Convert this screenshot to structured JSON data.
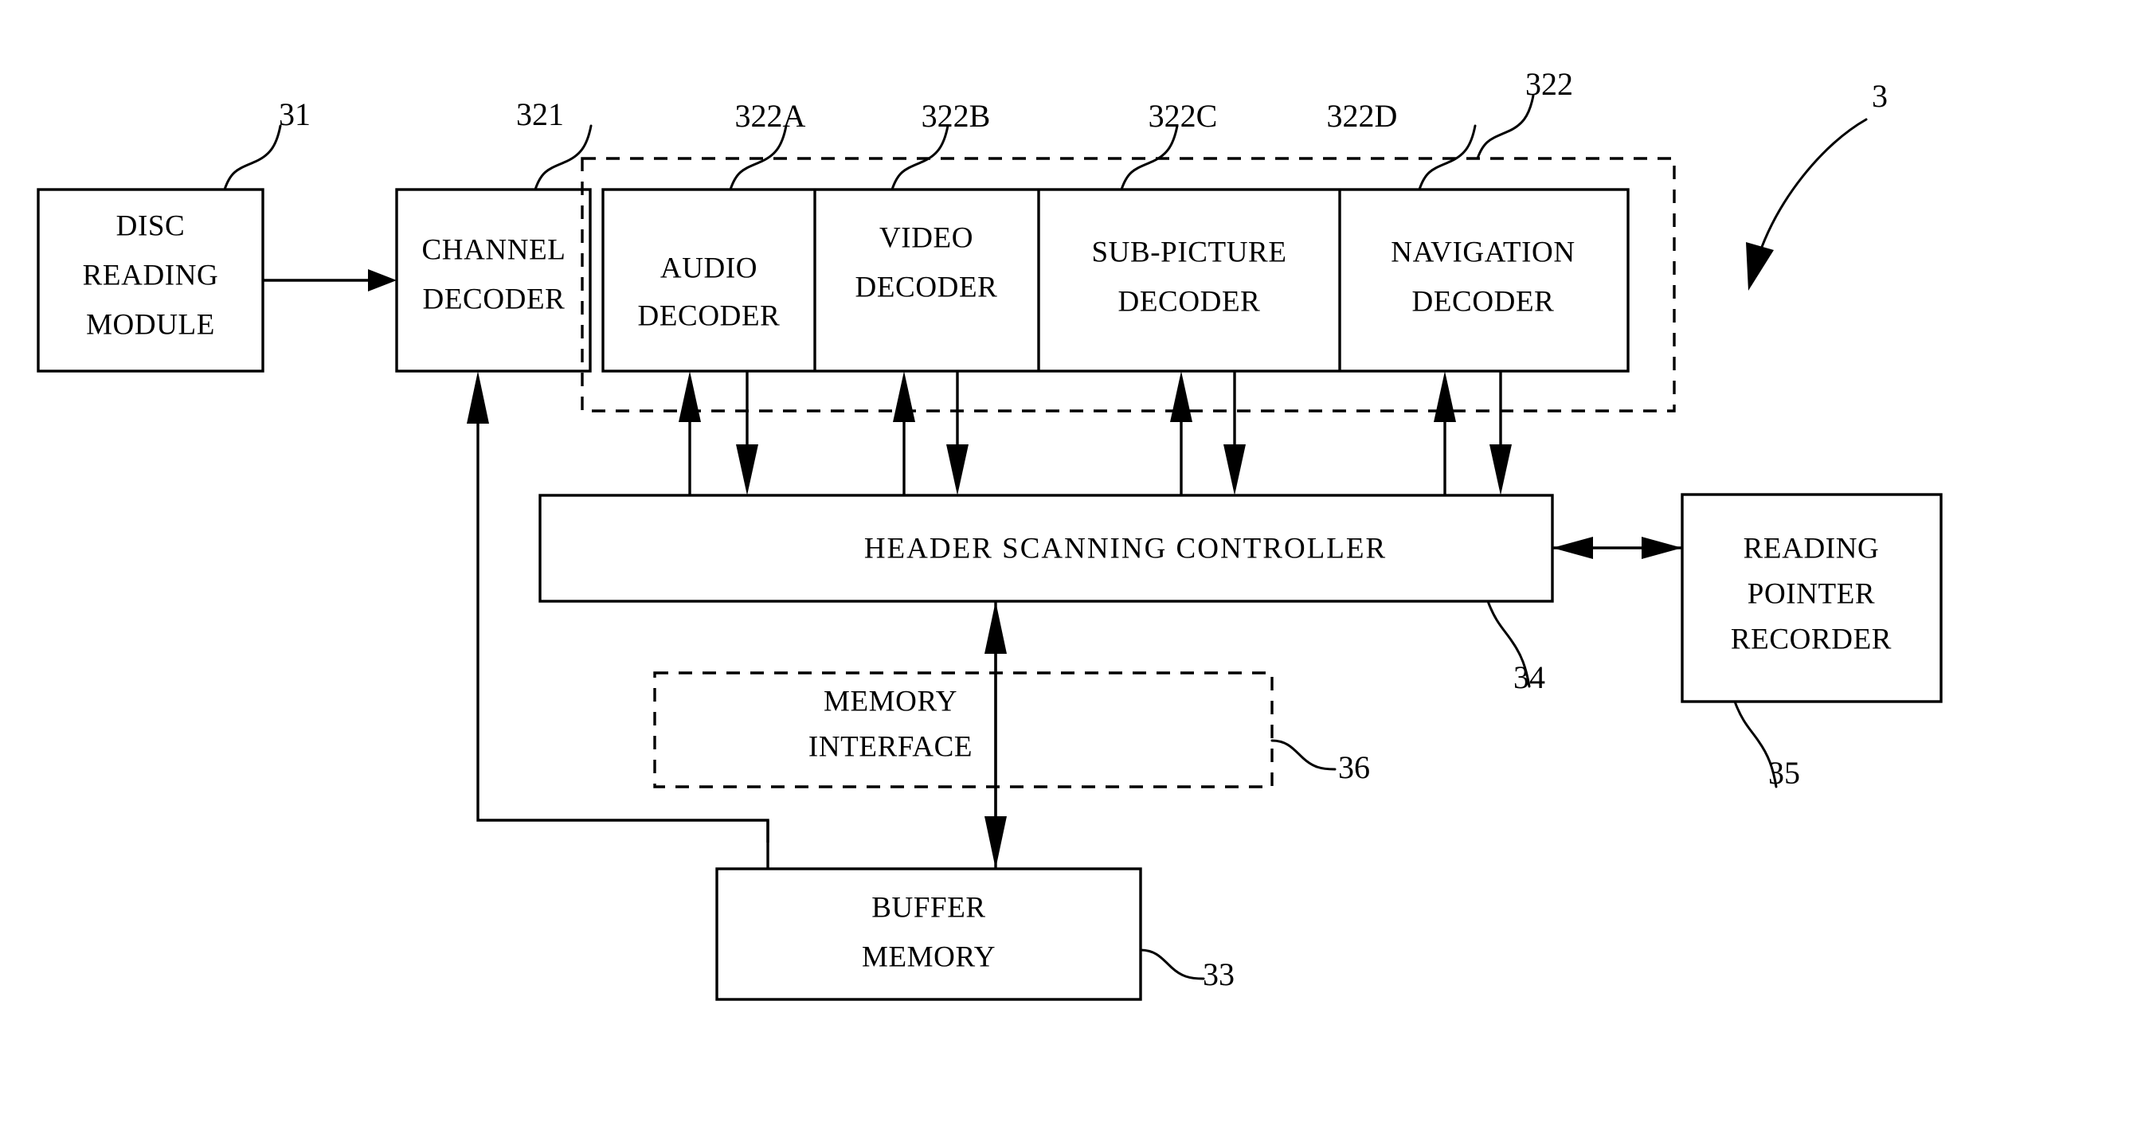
{
  "figure": {
    "type": "patent-block-diagram",
    "assembly_reference": "3",
    "background_color": "#ffffff",
    "line_color": "#000000"
  },
  "blocks": [
    {
      "id": "disc-reading-module",
      "lines": [
        "DISC",
        "READING",
        "MODULE"
      ],
      "reference": "31",
      "style": "solid"
    },
    {
      "id": "channel-decoder",
      "lines": [
        "CHANNEL",
        "DECODER"
      ],
      "reference": "321",
      "style": "solid"
    },
    {
      "id": "audio-decoder",
      "lines": [
        "AUDIO",
        "DECODER"
      ],
      "reference": "322A",
      "style": "solid"
    },
    {
      "id": "video-decoder",
      "lines": [
        "VIDEO",
        "DECODER"
      ],
      "reference": "322B",
      "style": "solid"
    },
    {
      "id": "sub-picture-decoder",
      "lines": [
        "SUB-PICTURE",
        "DECODER"
      ],
      "reference": "322C",
      "style": "solid"
    },
    {
      "id": "navigation-decoder",
      "lines": [
        "NAVIGATION",
        "DECODER"
      ],
      "reference": "322D",
      "style": "solid"
    },
    {
      "id": "decoder-group",
      "lines": [],
      "reference": "322",
      "style": "dashed"
    },
    {
      "id": "header-scanning-controller",
      "lines": [
        "HEADER SCANNING CONTROLLER"
      ],
      "reference": "34",
      "style": "solid"
    },
    {
      "id": "reading-pointer-recorder",
      "lines": [
        "READING",
        "POINTER",
        "RECORDER"
      ],
      "reference": "35",
      "style": "solid"
    },
    {
      "id": "memory-interface",
      "lines": [
        "MEMORY",
        "INTERFACE"
      ],
      "reference": "36",
      "style": "dashed"
    },
    {
      "id": "buffer-memory",
      "lines": [
        "BUFFER",
        "MEMORY"
      ],
      "reference": "33",
      "style": "solid"
    }
  ],
  "labels": {
    "disc_l1": "DISC",
    "disc_l2": "READING",
    "disc_l3": "MODULE",
    "channel_l1": "CHANNEL",
    "channel_l2": "DECODER",
    "audio_l1": "AUDIO",
    "audio_l2": "DECODER",
    "video_l1": "VIDEO",
    "video_l2": "DECODER",
    "subpic_l1": "SUB-PICTURE",
    "subpic_l2": "DECODER",
    "nav_l1": "NAVIGATION",
    "nav_l2": "DECODER",
    "hsc": "HEADER SCANNING CONTROLLER",
    "rpr_l1": "READING",
    "rpr_l2": "POINTER",
    "rpr_l3": "RECORDER",
    "mem_l1": "MEMORY",
    "mem_l2": "INTERFACE",
    "buf_l1": "BUFFER",
    "buf_l2": "MEMORY"
  },
  "references": {
    "r31": "31",
    "r321": "321",
    "r322A": "322A",
    "r322B": "322B",
    "r322C": "322C",
    "r322D": "322D",
    "r322": "322",
    "r3": "3",
    "r34": "34",
    "r35": "35",
    "r36": "36",
    "r33": "33"
  },
  "connections": [
    {
      "id": "disc-to-channel",
      "from": "disc-reading-module",
      "to": "channel-decoder",
      "arrow": "single"
    },
    {
      "id": "audio-up",
      "from": "header-scanning-controller",
      "to": "audio-decoder",
      "arrow": "single"
    },
    {
      "id": "audio-down",
      "from": "audio-decoder",
      "to": "header-scanning-controller",
      "arrow": "single"
    },
    {
      "id": "video-up",
      "from": "header-scanning-controller",
      "to": "video-decoder",
      "arrow": "single"
    },
    {
      "id": "video-down",
      "from": "video-decoder",
      "to": "header-scanning-controller",
      "arrow": "single"
    },
    {
      "id": "subpicture-up",
      "from": "header-scanning-controller",
      "to": "sub-picture-decoder",
      "arrow": "single"
    },
    {
      "id": "subpicture-down",
      "from": "sub-picture-decoder",
      "to": "header-scanning-controller",
      "arrow": "single"
    },
    {
      "id": "navigation-up",
      "from": "header-scanning-controller",
      "to": "navigation-decoder",
      "arrow": "single"
    },
    {
      "id": "navigation-down",
      "from": "navigation-decoder",
      "to": "header-scanning-controller",
      "arrow": "single"
    },
    {
      "id": "hsc-to-rpr",
      "from": "header-scanning-controller",
      "to": "reading-pointer-recorder",
      "arrow": "double"
    },
    {
      "id": "buffer-to-channel",
      "from": "buffer-memory",
      "to": "channel-decoder",
      "arrow": "single"
    },
    {
      "id": "channel-to-buffer",
      "from": "channel-decoder",
      "to": "buffer-memory",
      "arrow": "single"
    },
    {
      "id": "buffer-to-hsc",
      "from": "buffer-memory",
      "to": "header-scanning-controller",
      "arrow": "single"
    },
    {
      "id": "hsc-to-buffer",
      "from": "header-scanning-controller",
      "to": "buffer-memory",
      "arrow": "single"
    }
  ]
}
